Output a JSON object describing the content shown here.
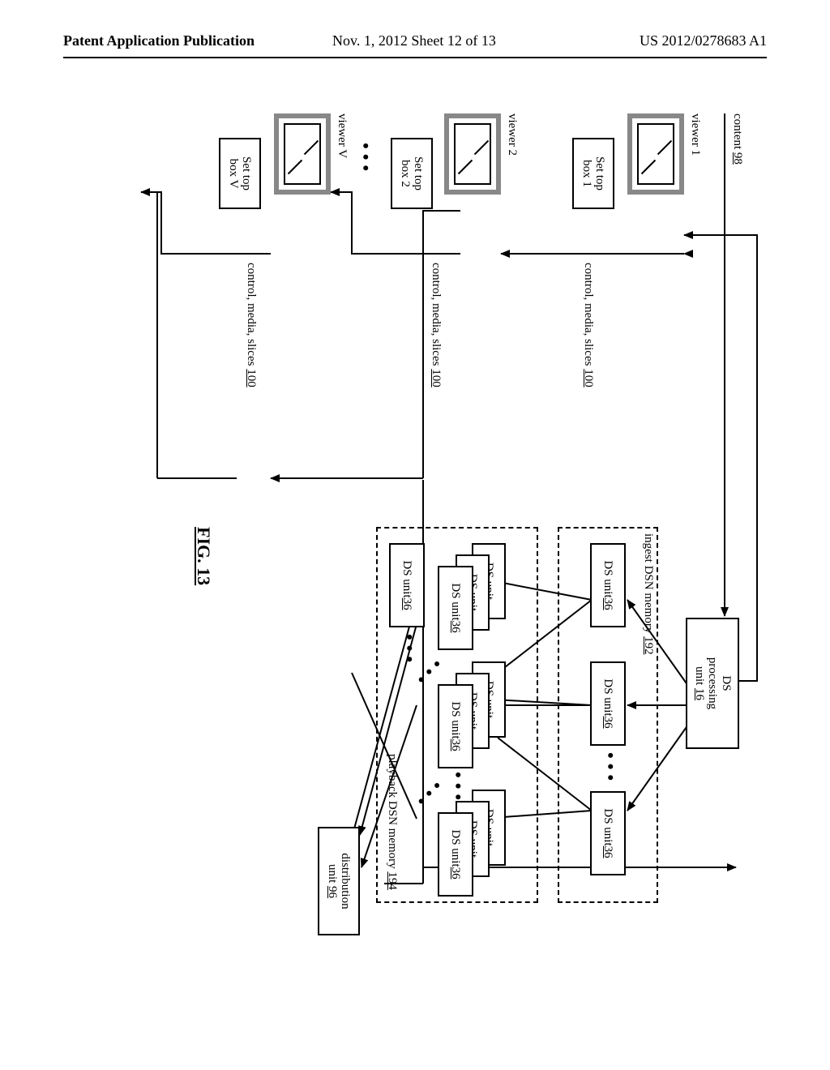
{
  "header": {
    "left": "Patent Application Publication",
    "mid": "Nov. 1, 2012  Sheet 12 of 13",
    "right": "US 2012/0278683 A1"
  },
  "fig_label": "FIG. 13",
  "content_label": "content ",
  "content_ref": "98",
  "cms_label": "control, media, slices ",
  "cms_ref": "100",
  "ds_proc_line1": "DS",
  "ds_proc_line2": "processing",
  "ds_proc_line3": "unit ",
  "ds_proc_ref": "16",
  "ds_unit_label": "DS unit ",
  "ds_unit_ref": "36",
  "ds_unit_short": "DS unit",
  "ingest_label": "ingest DSN memory ",
  "ingest_ref": "192",
  "playback_label": "playback DSN memory ",
  "playback_ref": "194",
  "dist_line1": "distribution",
  "dist_line2": "unit ",
  "dist_ref": "96",
  "viewers": {
    "v1": "viewer 1",
    "v2": "viewer 2",
    "vV": "viewer V"
  },
  "stb": {
    "b1a": "Set top",
    "b1b": "box 1",
    "b2a": "Set top",
    "b2b": "box 2",
    "bVa": "Set top",
    "bVb": "box V"
  },
  "dots": "•••"
}
